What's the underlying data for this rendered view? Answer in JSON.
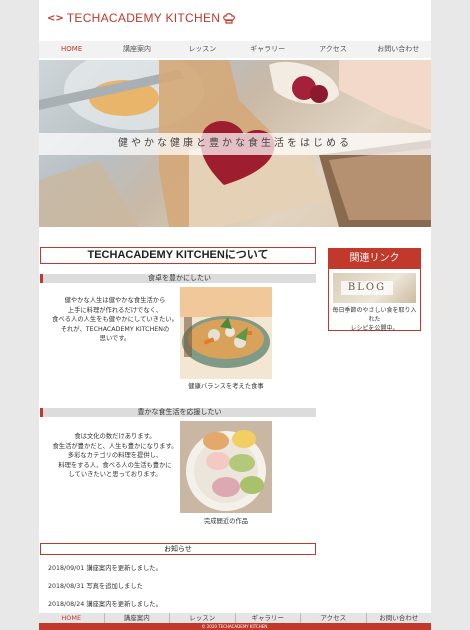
{
  "header": {
    "logo_mark": "<>",
    "logo_text_a": "TECHACADEMY",
    "logo_text_b": " KITCHEN"
  },
  "nav": [
    "HOME",
    "講座案内",
    "レッスン",
    "ギャラリー",
    "アクセス",
    "お問い合わせ"
  ],
  "hero": {
    "tagline": "健やかな健康と豊かな食生活をはじめる"
  },
  "main": {
    "title": "TECHACADEMY KITCHENについて",
    "sections": [
      {
        "heading": "食卓を豊かにしたい",
        "lines": [
          "健やかな人生は健やかな食生活から",
          "上手に料理が作れるだけでなく、",
          "食べる人の人生をも健やかにしていきたい。",
          "それが、TECHACADEMY KITCHENの",
          "思いです。"
        ],
        "caption": "健康バランスを考えた食事"
      },
      {
        "heading": "豊かな食生活を応援したい",
        "lines": [
          "食は文化の数だけあります。",
          "食生活が豊かだと、人生も豊かになります。",
          "多彩なカテゴリの料理を提供し、",
          "料理をする人、食べる人の生活も豊かに",
          "していきたいと思っております。"
        ],
        "caption": "完成間近の作品"
      }
    ]
  },
  "news": {
    "heading": "お知らせ",
    "items": [
      {
        "date": "2018/09/01",
        "text": "講座案内を更新しました。"
      },
      {
        "date": "2018/08/31",
        "text": "写真を追加しました"
      },
      {
        "date": "2018/08/24",
        "text": "講座案内を更新しました。"
      }
    ]
  },
  "sidebar": {
    "heading": "関連リンク",
    "banner": "BLOG",
    "text_1": "毎日季節のやさしい食を取り入れた",
    "text_2": "レシピを公開中。"
  },
  "footer": {
    "nav": [
      "HOME",
      "講座案内",
      "レッスン",
      "ギャラリー",
      "アクセス",
      "お問い合わせ"
    ],
    "copyright": "© 2020 TECHACADEMY KITCHEN."
  },
  "colors": {
    "accent": "#c0392b",
    "nav_bg": "#f2f2f2",
    "heading_bar": "#dcdcdc"
  }
}
